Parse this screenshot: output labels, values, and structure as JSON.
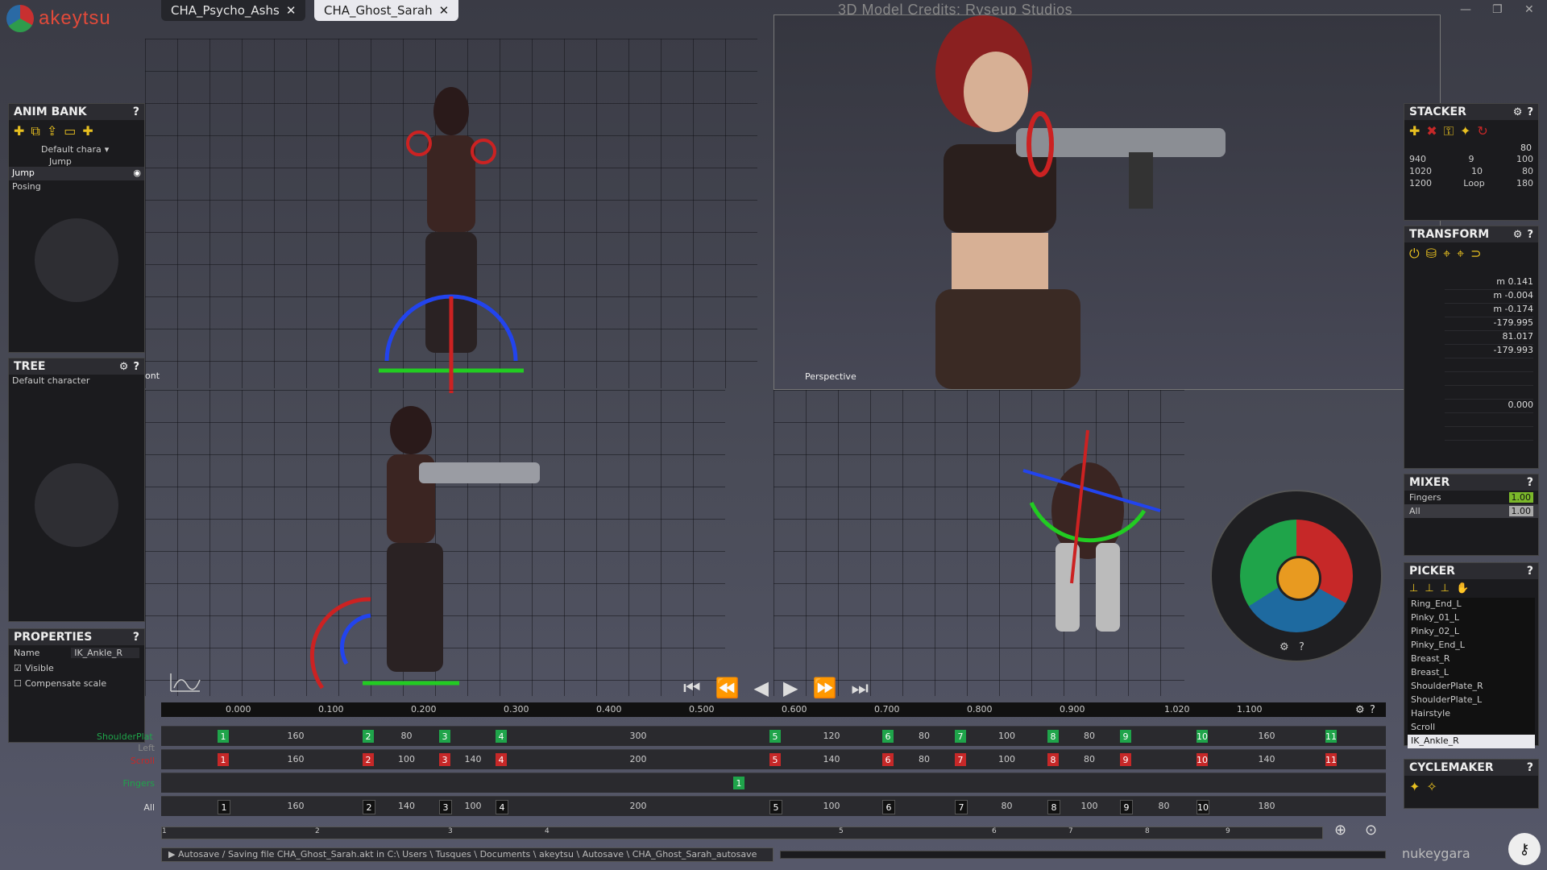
{
  "app": {
    "logo_text": "akeytsu",
    "credits": "3D Model Credits: Ryseup Studios",
    "brand": "nukeygara"
  },
  "tabs": [
    {
      "label": "CHA_Psycho_Ashs",
      "close": "✕"
    },
    {
      "label": "CHA_Ghost_Sarah",
      "close": "✕"
    }
  ],
  "window": {
    "minimize": "—",
    "restore": "❐",
    "close": "✕"
  },
  "viewports": {
    "front_label": "ont",
    "perspective_label": "Perspective"
  },
  "anim_bank": {
    "title": "ANIM BANK",
    "character": "Default chara",
    "selected_clip": "Jump",
    "clips": [
      "Jump",
      "Posing"
    ]
  },
  "tree": {
    "title": "TREE",
    "root": "Default character"
  },
  "properties": {
    "title": "PROPERTIES",
    "name_label": "Name",
    "name_value": "IK_Ankle_R",
    "visible_label": "Visible",
    "compensate_label": "Compensate scale"
  },
  "stacker": {
    "title": "STACKER",
    "value_top": "80",
    "rows": [
      {
        "left": "940",
        "mid": "9",
        "right": "100"
      },
      {
        "left": "1020",
        "mid": "10",
        "right": "80"
      },
      {
        "left": "1200",
        "mid": "Loop",
        "right": "180"
      }
    ]
  },
  "transform": {
    "title": "TRANSFORM",
    "values": [
      "m 0.141",
      "m -0.004",
      "m -0.174",
      "-179.995",
      "81.017",
      "-179.993",
      "",
      "",
      "",
      "0.000",
      "",
      ""
    ]
  },
  "mixer": {
    "title": "MIXER",
    "rows": [
      {
        "label": "Fingers",
        "value": "1.00"
      },
      {
        "label": "All",
        "value": "1.00"
      }
    ]
  },
  "picker": {
    "title": "PICKER",
    "items": [
      "Ring_End_L",
      "Pinky_01_L",
      "Pinky_02_L",
      "Pinky_End_L",
      "Breast_R",
      "Breast_L",
      "ShoulderPlate_R",
      "ShoulderPlate_L",
      "Hairstyle",
      "Scroll",
      "IK_Ankle_R"
    ],
    "selected": "IK_Ankle_R"
  },
  "cyclemaker": {
    "title": "CYCLEMAKER"
  },
  "timeline": {
    "ruler_ticks": [
      "0.000",
      "0.100",
      "0.200",
      "0.300",
      "0.400",
      "0.500",
      "0.600",
      "0.700",
      "0.800",
      "0.900",
      "1.020",
      "1.100"
    ],
    "track_labels": [
      "ShoulderPlat",
      "Left",
      "Scroll",
      "Fingers",
      "All"
    ],
    "track1": {
      "keys": [
        "1",
        "2",
        "3",
        "4",
        "5",
        "6",
        "7",
        "8",
        "9",
        "10",
        "11"
      ],
      "segs": [
        "160",
        "80",
        "",
        "300",
        "120",
        "80",
        "100",
        "80",
        "",
        "160"
      ]
    },
    "track2": {
      "keys": [
        "1",
        "2",
        "3",
        "4",
        "5",
        "6",
        "7",
        "8",
        "9",
        "10",
        "11"
      ],
      "segs": [
        "160",
        "100",
        "140",
        "200",
        "140",
        "80",
        "100",
        "80",
        "",
        "140"
      ]
    },
    "track3": {
      "keys": [
        "1"
      ]
    },
    "track4": {
      "keys": [
        "1",
        "2",
        "3",
        "4",
        "5",
        "6",
        "7",
        "8",
        "9",
        "10"
      ],
      "segs": [
        "160",
        "140",
        "100",
        "200",
        "100",
        "",
        "80",
        "100",
        "80",
        "180"
      ]
    },
    "scroll_marks": [
      "1",
      "2",
      "3",
      "4",
      "5",
      "6",
      "7",
      "8",
      "9"
    ]
  },
  "status": "▶ Autosave / Saving file CHA_Ghost_Sarah.akt in C:\\ Users \\ Tusques \\ Documents \\ akeytsu \\ Autosave \\ CHA_Ghost_Sarah_autosave",
  "colors": {
    "accent_red": "#c62828",
    "accent_green": "#1fa44a",
    "accent_blue": "#1e6aa0",
    "accent_yellow": "#e89a20"
  }
}
